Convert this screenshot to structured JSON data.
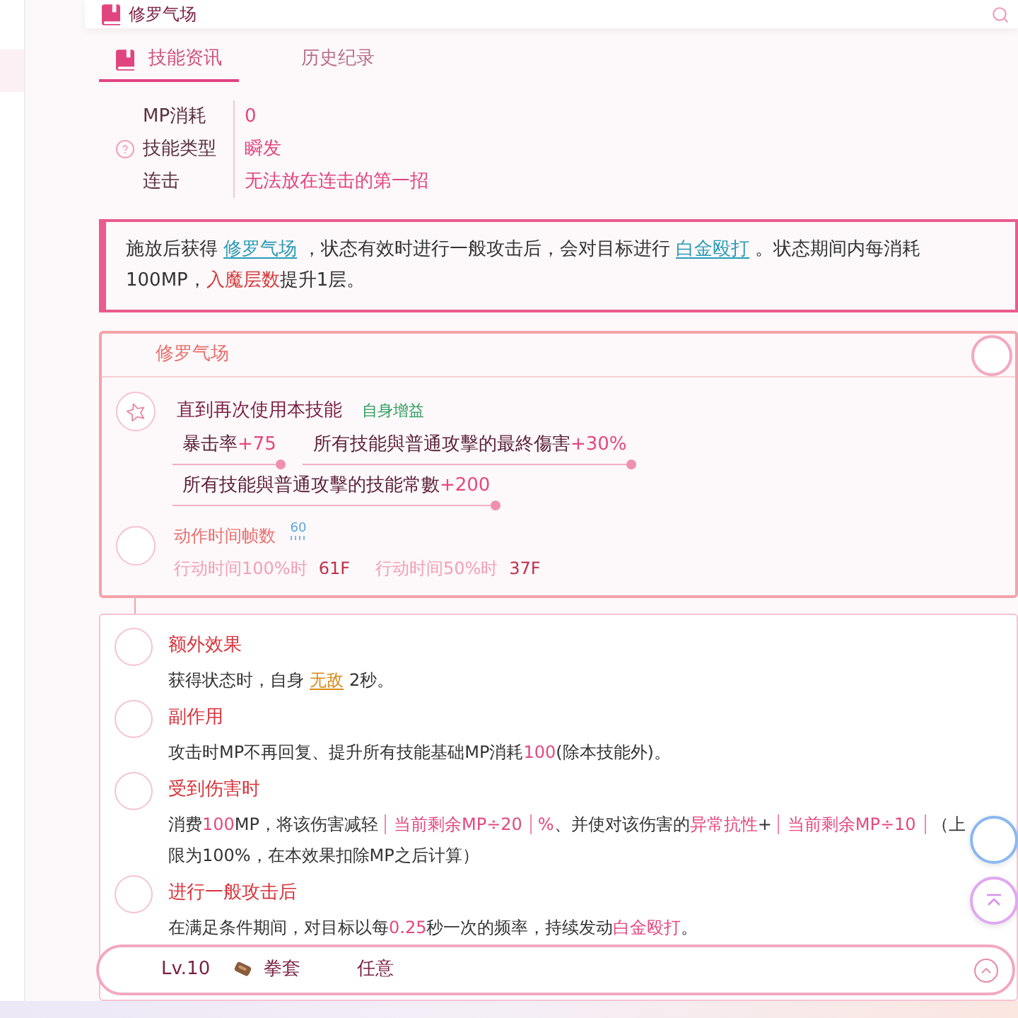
{
  "header": {
    "title": "修罗气场"
  },
  "tabs": [
    {
      "label": "技能资讯",
      "selected": true
    },
    {
      "label": "历史纪录",
      "selected": false
    }
  ],
  "info": [
    {
      "label": "MP消耗",
      "value": "0",
      "help": false
    },
    {
      "label": "技能类型",
      "value": "瞬发",
      "help": true
    },
    {
      "label": "连击",
      "value": "无法放在连击的第一招",
      "help": false
    }
  ],
  "description": [
    {
      "kind": "text",
      "text": "施放后获得"
    },
    {
      "kind": "link",
      "text": "修罗气场"
    },
    {
      "kind": "text",
      "text": "，状态有效时进行一般攻击后，会对目标进行"
    },
    {
      "kind": "link",
      "text": "白金殴打"
    },
    {
      "kind": "text",
      "text": "。状态期间内每消耗100MP，"
    },
    {
      "kind": "emphasis",
      "text": "入魔层数"
    },
    {
      "kind": "text",
      "text": "提升1层。"
    }
  ],
  "buff": {
    "title": "修罗气场",
    "duration": "直到再次使用本技能",
    "tag": "自身增益",
    "stats": [
      {
        "name": "暴击率",
        "value": "+75"
      },
      {
        "name": "所有技能與普通攻擊的最終傷害",
        "value": "+30%"
      },
      {
        "name": "所有技能與普通攻擊的技能常數",
        "value": "+200"
      }
    ],
    "frames": {
      "title": "动作时间帧数",
      "fps": "60",
      "items": [
        {
          "label": "行动时间100%时",
          "value": "61F"
        },
        {
          "label": "行动时间50%时",
          "value": "37F"
        }
      ]
    }
  },
  "effects": [
    {
      "title": "额外效果",
      "segments": [
        {
          "kind": "text",
          "text": "获得状态时，自身"
        },
        {
          "kind": "status",
          "text": "无敌"
        },
        {
          "kind": "text",
          "text": "2秒。"
        }
      ]
    },
    {
      "title": "副作用",
      "segments": [
        {
          "kind": "text",
          "text": "攻击时MP不再回复、提升所有技能基础MP消耗"
        },
        {
          "kind": "number",
          "text": "100"
        },
        {
          "kind": "text",
          "text": "(除本技能外)。"
        }
      ]
    },
    {
      "title": "受到伤害时",
      "segments": [
        {
          "kind": "text",
          "text": "消费"
        },
        {
          "kind": "number",
          "text": "100"
        },
        {
          "kind": "text",
          "text": "MP，将该伤害减轻"
        },
        {
          "kind": "formula",
          "text": "当前剩余MP÷20"
        },
        {
          "kind": "number",
          "text": "%"
        },
        {
          "kind": "text",
          "text": "、并使对该伤害的"
        },
        {
          "kind": "number",
          "text": "异常抗性"
        },
        {
          "kind": "text",
          "text": "+"
        },
        {
          "kind": "formula",
          "text": "当前剩余MP÷10"
        },
        {
          "kind": "text",
          "text": "（上限为100%，在本效果扣除MP之后计算）"
        }
      ]
    },
    {
      "title": "进行一般攻击后",
      "segments": [
        {
          "kind": "text",
          "text": "在满足条件期间，对目标以每"
        },
        {
          "kind": "number",
          "text": "0.25"
        },
        {
          "kind": "text",
          "text": "秒一次的频率，持续发动"
        },
        {
          "kind": "number",
          "text": "白金殴打"
        },
        {
          "kind": "text",
          "text": "。"
        }
      ]
    }
  ],
  "bottom_bar": {
    "lv": "Lv.10",
    "weapon": "拳套",
    "combo": "任意"
  }
}
